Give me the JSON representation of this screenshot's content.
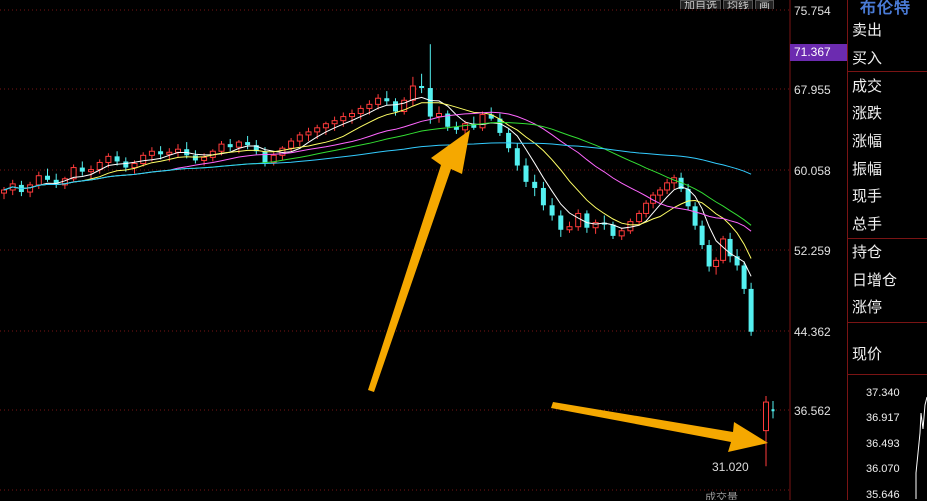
{
  "chart_data": {
    "type": "candlestick",
    "y_ticks": [
      "75.754",
      "67.955",
      "60.058",
      "52.259",
      "44.362",
      "36.562"
    ],
    "current_price_label": "71.367",
    "low_label": "31.020",
    "ylim": [
      31.0,
      76.0
    ],
    "ma_colors": {
      "ma5": "#ffffff",
      "ma10": "#ffff66",
      "ma20": "#ff66ff",
      "ma30": "#33dd33",
      "ma60": "#33ccff"
    },
    "candles_1": [
      [
        57.8,
        58.4,
        57.2,
        58.1
      ],
      [
        58.1,
        59.1,
        57.6,
        58.7
      ],
      [
        58.6,
        59.0,
        57.5,
        57.9
      ],
      [
        57.9,
        58.9,
        57.4,
        58.6
      ],
      [
        58.6,
        59.9,
        58.2,
        59.5
      ],
      [
        59.5,
        60.2,
        58.9,
        59.1
      ],
      [
        59.1,
        59.7,
        58.3,
        58.6
      ],
      [
        58.6,
        59.4,
        58.2,
        59.2
      ],
      [
        59.2,
        60.6,
        58.9,
        60.3
      ],
      [
        60.3,
        60.9,
        59.5,
        59.9
      ],
      [
        59.9,
        60.5,
        59.2,
        60.1
      ],
      [
        60.1,
        61.1,
        59.7,
        60.8
      ],
      [
        60.8,
        61.7,
        60.3,
        61.4
      ],
      [
        61.4,
        61.9,
        60.5,
        60.9
      ],
      [
        60.9,
        61.3,
        59.9,
        60.3
      ],
      [
        60.3,
        61.0,
        59.7,
        60.7
      ],
      [
        60.7,
        61.8,
        60.4,
        61.5
      ],
      [
        61.5,
        62.3,
        60.9,
        61.9
      ],
      [
        61.9,
        62.4,
        61.1,
        61.6
      ],
      [
        61.6,
        62.2,
        60.9,
        61.8
      ],
      [
        61.8,
        62.6,
        61.3,
        62.1
      ],
      [
        62.1,
        62.8,
        61.2,
        61.5
      ],
      [
        61.5,
        62.0,
        60.7,
        61.0
      ],
      [
        61.0,
        61.7,
        60.5,
        61.3
      ],
      [
        61.3,
        62.1,
        60.9,
        61.9
      ],
      [
        61.9,
        62.9,
        61.5,
        62.6
      ],
      [
        62.6,
        63.1,
        61.9,
        62.3
      ],
      [
        62.3,
        63.0,
        61.7,
        62.8
      ],
      [
        62.8,
        63.4,
        62.1,
        62.5
      ],
      [
        62.5,
        63.0,
        61.6,
        61.9
      ],
      [
        61.9,
        62.3,
        60.4,
        60.8
      ],
      [
        60.8,
        61.8,
        60.5,
        61.5
      ],
      [
        61.5,
        62.4,
        61.0,
        62.2
      ],
      [
        62.2,
        63.2,
        61.9,
        62.9
      ],
      [
        62.9,
        63.8,
        62.4,
        63.5
      ],
      [
        63.5,
        64.2,
        62.9,
        63.8
      ],
      [
        63.8,
        64.5,
        63.1,
        64.2
      ],
      [
        64.2,
        64.8,
        63.5,
        64.6
      ],
      [
        64.6,
        65.3,
        63.9,
        64.9
      ],
      [
        64.9,
        65.7,
        64.3,
        65.3
      ],
      [
        65.3,
        66.0,
        64.6,
        65.6
      ],
      [
        65.6,
        66.4,
        65.0,
        66.1
      ],
      [
        66.1,
        66.9,
        65.5,
        66.5
      ],
      [
        66.5,
        67.5,
        66.0,
        67.1
      ],
      [
        67.1,
        67.8,
        66.4,
        66.8
      ],
      [
        66.8,
        67.1,
        65.4,
        65.8
      ],
      [
        65.8,
        67.2,
        65.5,
        66.9
      ],
      [
        66.9,
        69.2,
        66.3,
        68.3
      ],
      [
        68.3,
        69.5,
        67.6,
        68.1
      ],
      [
        68.1,
        72.4,
        64.6,
        65.3
      ],
      [
        65.3,
        66.3,
        64.7,
        65.6
      ],
      [
        65.6,
        65.9,
        63.9,
        64.3
      ],
      [
        64.3,
        64.8,
        63.6,
        64.0
      ],
      [
        64.0,
        64.9,
        63.5,
        64.6
      ],
      [
        64.6,
        65.3,
        64.0,
        64.2
      ],
      [
        64.2,
        65.8,
        63.9,
        65.5
      ],
      [
        65.5,
        66.2,
        64.9,
        65.1
      ],
      [
        65.1,
        65.6,
        63.4,
        63.7
      ],
      [
        63.7,
        64.1,
        61.8,
        62.2
      ],
      [
        62.2,
        62.7,
        60.0,
        60.5
      ],
      [
        60.5,
        61.2,
        58.4,
        58.9
      ],
      [
        58.9,
        59.6,
        57.5,
        58.3
      ],
      [
        58.3,
        58.9,
        56.1,
        56.6
      ],
      [
        56.6,
        57.3,
        55.1,
        55.6
      ],
      [
        55.6,
        56.1,
        53.5,
        54.2
      ],
      [
        54.2,
        55.0,
        53.9,
        54.5
      ],
      [
        54.5,
        56.2,
        54.1,
        55.8
      ],
      [
        55.8,
        56.1,
        53.9,
        54.4
      ],
      [
        54.4,
        55.2,
        53.8,
        54.9
      ],
      [
        54.9,
        55.6,
        54.2,
        54.7
      ],
      [
        54.7,
        55.0,
        53.3,
        53.6
      ],
      [
        53.6,
        54.4,
        53.2,
        54.1
      ],
      [
        54.1,
        55.3,
        53.8,
        55.0
      ]
    ],
    "candles_2": [
      [
        55.0,
        56.1,
        54.7,
        55.8
      ],
      [
        55.8,
        57.1,
        55.4,
        56.8
      ],
      [
        56.8,
        57.9,
        56.3,
        57.6
      ],
      [
        57.6,
        58.4,
        56.9,
        58.1
      ],
      [
        58.1,
        59.2,
        57.7,
        58.8
      ],
      [
        58.8,
        59.6,
        58.2,
        59.3
      ],
      [
        59.3,
        59.8,
        57.9,
        58.2
      ],
      [
        58.2,
        58.7,
        56.1,
        56.5
      ],
      [
        56.5,
        56.9,
        54.2,
        54.6
      ],
      [
        54.6,
        55.1,
        52.3,
        52.7
      ],
      [
        52.7,
        53.2,
        50.1,
        50.6
      ],
      [
        50.6,
        51.5,
        49.8,
        51.2
      ],
      [
        51.2,
        53.6,
        50.9,
        53.3
      ],
      [
        53.3,
        53.9,
        51.0,
        51.6
      ],
      [
        51.6,
        52.3,
        50.2,
        50.7
      ],
      [
        50.7,
        51.1,
        47.9,
        48.4
      ],
      [
        48.4,
        49.0,
        43.8,
        44.2
      ]
    ],
    "last_candles": [
      [
        34.5,
        37.9,
        31.0,
        37.3
      ],
      [
        36.6,
        37.4,
        35.7,
        36.4
      ]
    ],
    "mini_ticks": [
      "37.340",
      "36.917",
      "36.493",
      "36.070",
      "35.646"
    ]
  },
  "toolbar": {
    "btn1": "加自选",
    "btn2": "均线",
    "btn3": "画"
  },
  "panel": {
    "title": "布伦特",
    "sell": "卖出",
    "buy": "买入",
    "volume": "成交",
    "change": "涨跌",
    "change_pct": "涨幅",
    "amplitude": "振幅",
    "current_hand": "现手",
    "total_hand": "总手",
    "open_interest": "持仓",
    "daily_oi_change": "日增仓",
    "limit_up": "涨停",
    "price": "现价"
  },
  "bottom": {
    "label": "成交量"
  },
  "colors": {
    "up": "#ff3b3b",
    "down": "#54f0f0",
    "grid": "#7a1414",
    "arrow": "#f5a800"
  }
}
